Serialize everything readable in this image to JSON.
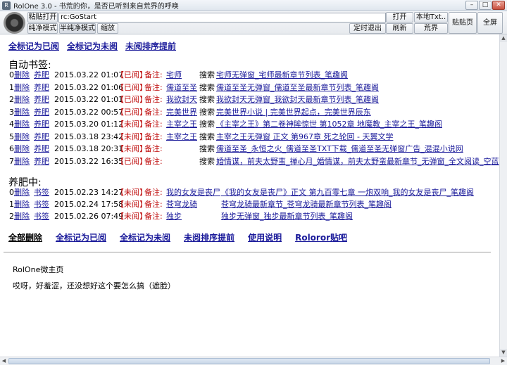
{
  "window": {
    "title": "RolOne 3.0 - 书荒的你，是否已听到来自荒界的呼唤"
  },
  "toolbar": {
    "paste_open": "粘贴打开",
    "url_value": "rc:GoStart",
    "open": "打开",
    "local_txt": "本地Txt..",
    "pure_mode": "纯净模式",
    "semi_pure_mode": "半纯净模式",
    "shrink": "缩放",
    "timed_exit": "定时退出",
    "refresh": "刷新",
    "wasteland": "荒界",
    "sticky_page": "贴贴页",
    "fullscreen": "全屏"
  },
  "top_actions": [
    "全标记为已阅",
    "全标记为未阅",
    "未阅排序提前"
  ],
  "auto_section": {
    "title": "自动书签:",
    "rows": [
      {
        "idx": "0",
        "del": "删除",
        "act": "养肥",
        "time": "2015.03.22 01:07",
        "status": "【已阅】",
        "note_label": "备注:",
        "note": "宅师",
        "search": "搜索",
        "title": "宅师无弹窗_宅师最新章节列表_笔趣阁"
      },
      {
        "idx": "1",
        "del": "删除",
        "act": "养肥",
        "time": "2015.03.22 01:06",
        "status": "【已阅】",
        "note_label": "备注:",
        "note": "儒道至圣",
        "search": "搜索",
        "title": "儒道至圣无弹窗_儒道至圣最新章节列表_笔趣阁"
      },
      {
        "idx": "2",
        "del": "删除",
        "act": "养肥",
        "time": "2015.03.22 01:01",
        "status": "【已阅】",
        "note_label": "备注:",
        "note": "我欲封天",
        "search": "搜索",
        "title": "我欲封天无弹窗_我欲封天最新章节列表_笔趣阁"
      },
      {
        "idx": "3",
        "del": "删除",
        "act": "养肥",
        "time": "2015.03.22 00:57",
        "status": "【已阅】",
        "note_label": "备注:",
        "note": "完美世界",
        "search": "搜索",
        "title": "完美世界小说 | 完美世界起点，完美世界辰东"
      },
      {
        "idx": "4",
        "del": "删除",
        "act": "养肥",
        "time": "2015.03.20 01:12",
        "status": "【未阅】",
        "note_label": "备注:",
        "note": "主宰之王",
        "search": "搜索",
        "title": "《主宰之王》第二卷神眸惊世 第1052章 地魔教_主宰之王_笔趣阁"
      },
      {
        "idx": "5",
        "del": "删除",
        "act": "养肥",
        "time": "2015.03.18 23:42",
        "status": "【未阅】",
        "note_label": "备注:",
        "note": "主宰之王",
        "search": "搜索",
        "title": "主宰之王无弹窗 正文 第967章 死之轮回 - 天翼文学"
      },
      {
        "idx": "6",
        "del": "删除",
        "act": "养肥",
        "time": "2015.03.18 20:31",
        "status": "【未阅】",
        "note_label": "备注:",
        "note": "",
        "search": "搜索",
        "title": "儒道至圣_永恒之火_儒道至圣TXT下载_儒道至圣无弹窗广告_混混小说网"
      },
      {
        "idx": "7",
        "del": "删除",
        "act": "养肥",
        "time": "2015.03.22 16:35",
        "status": "【已阅】",
        "note_label": "备注:",
        "note": "",
        "search": "搜索",
        "title": "婚情谋，前夫太野蛮_禅心月_婚情谋，前夫太野蛮最新章节_无弹窗_全文阅读_空蓝小说网"
      }
    ]
  },
  "fat_section": {
    "title": "养肥中:",
    "rows": [
      {
        "idx": "0",
        "del": "删除",
        "act": "书签",
        "time": "2015.02.23 14:27",
        "status": "【未阅】",
        "note_label": "备注:",
        "note": "我的女友是丧尸",
        "title": "《我的女友是丧尸》正文 第九百零七章 一炮双响_我的女友是丧尸_笔趣阁"
      },
      {
        "idx": "1",
        "del": "删除",
        "act": "书签",
        "time": "2015.02.24 17:58",
        "status": "【未阅】",
        "note_label": "备注:",
        "note": "苍穹龙骑",
        "title": "苍穹龙骑最新章节_苍穹龙骑最新章节列表_笔趣阁"
      },
      {
        "idx": "2",
        "del": "删除",
        "act": "书签",
        "time": "2015.02.26 07:49",
        "status": "【未阅】",
        "note_label": "备注:",
        "note": "独步",
        "title": "独步无弹窗_独步最新章节列表_笔趣阁"
      }
    ]
  },
  "bottom_actions": [
    "全部删除",
    "全标记为已阅",
    "全标记为未阅",
    "未阅排序提前",
    "使用说明",
    "Roloror贴吧"
  ],
  "footer": {
    "home_title": "RolOne微主页",
    "message": "哎呀，好羞涩，还没想好这个要怎么搞（遮脸）"
  },
  "colors": {
    "link": "#1a1a9a",
    "status": "#c01010"
  }
}
